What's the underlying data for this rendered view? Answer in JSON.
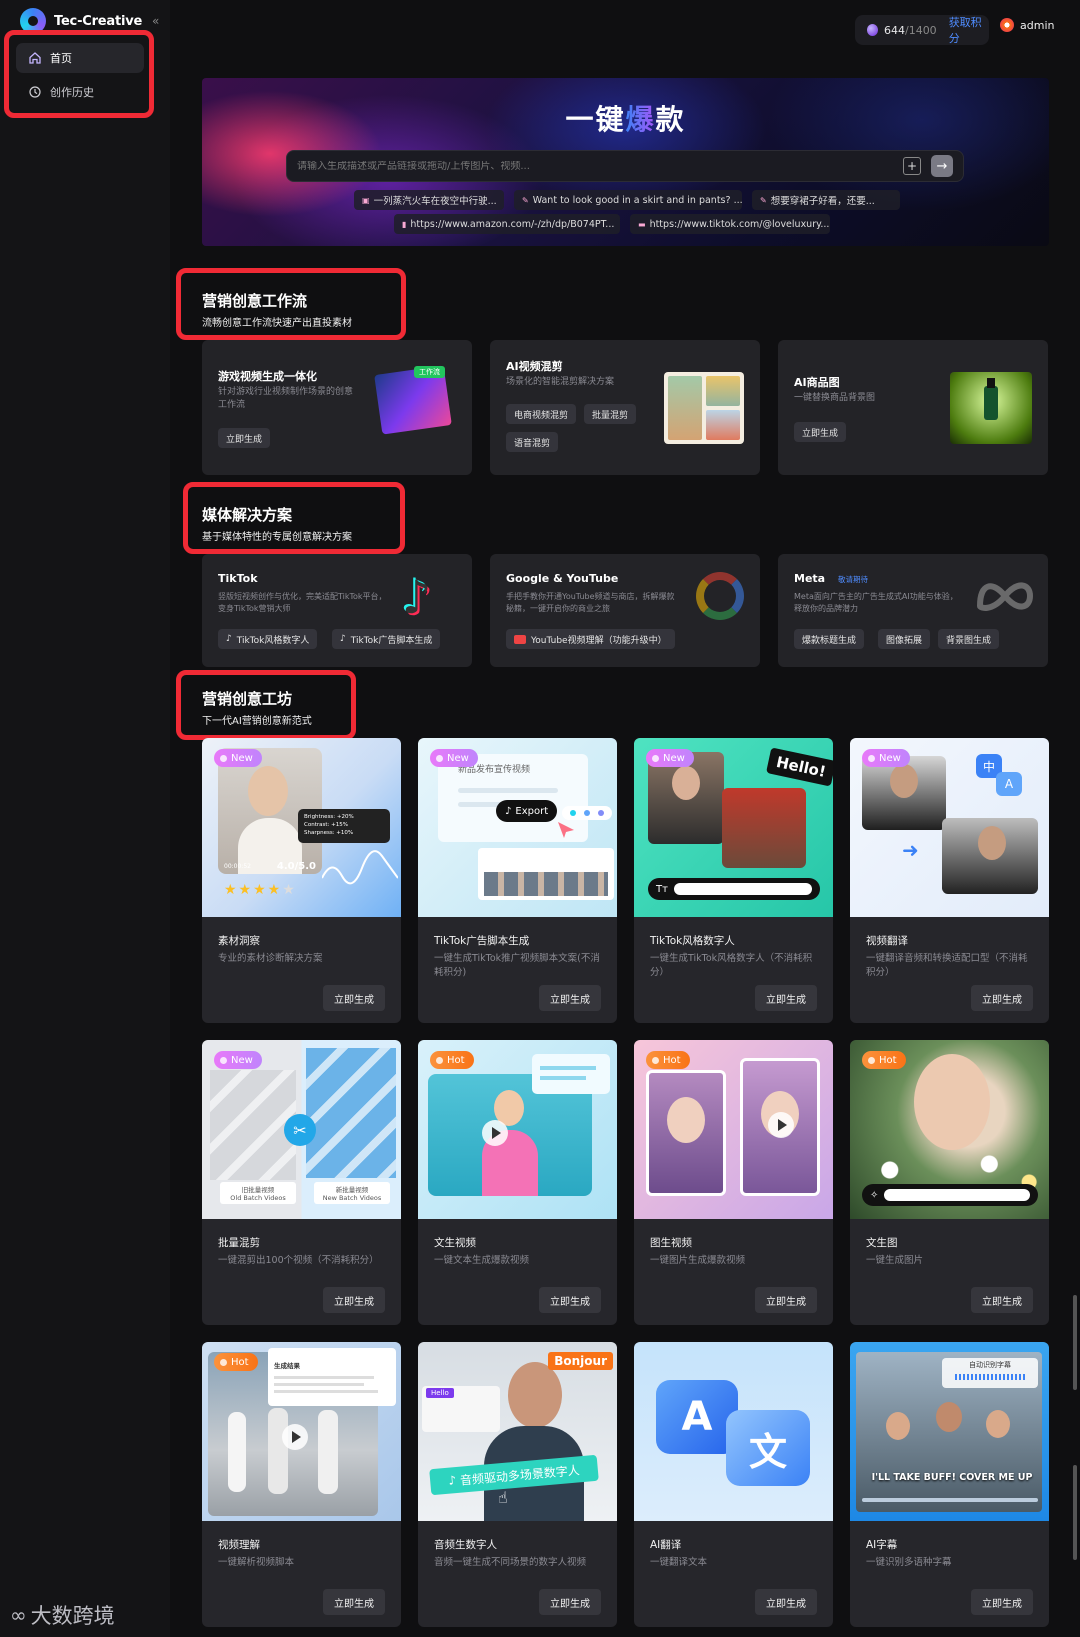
{
  "app": {
    "name": "Tec-Creative",
    "name_tm": "™",
    "collapse_icon": "chevrons-left-icon"
  },
  "sidebar": {
    "items": [
      {
        "label": "首页",
        "icon": "home-icon",
        "active": true
      },
      {
        "label": "创作历史",
        "icon": "history-icon",
        "active": false
      }
    ]
  },
  "topbar": {
    "credits_used": "644",
    "credits_total": "/1400",
    "earn_label": "获取积分",
    "user_name": "admin"
  },
  "hero": {
    "title_pre": "一键",
    "title_hl": "爆",
    "title_post": "款",
    "search_placeholder": "请输入生成描述或产品链接或拖动/上传图片、视频...",
    "chips": [
      "一列蒸汽火车在夜空中行驶...",
      "Want to look good in a skirt and in pants? ...",
      "想要穿裙子好看，还要...",
      "https://www.amazon.com/-/zh/dp/B074PT...",
      "https://www.tiktok.com/@loveluxury..."
    ]
  },
  "sections": {
    "workflow": {
      "title": "营销创意工作流",
      "subtitle": "流畅创意工作流快速产出直投素材"
    },
    "media": {
      "title": "媒体解决方案",
      "subtitle": "基于媒体特性的专属创意解决方案"
    },
    "workshop": {
      "title": "营销创意工坊",
      "subtitle": "下一代AI营销创意新范式"
    }
  },
  "workflow_cards": [
    {
      "title": "游戏视频生成一体化",
      "desc": "针对游戏行业视频制作场景的创意工作流",
      "buttons": [
        "立即生成"
      ],
      "tag": "工作流"
    },
    {
      "title": "AI视频混剪",
      "desc": "场景化的智能混剪解决方案",
      "buttons": [
        "电商视频混剪",
        "批量混剪",
        "语音混剪"
      ]
    },
    {
      "title": "AI商品图",
      "desc": "一键替换商品背景图",
      "buttons": [
        "立即生成"
      ]
    }
  ],
  "media_cards": [
    {
      "title": "TikTok",
      "desc": "竖版短视频创作与优化，完美适配TikTok平台，变身TikTok营销大师",
      "buttons": [
        "TikTok风格数字人",
        "TikTok广告脚本生成"
      ]
    },
    {
      "title": "Google & YouTube",
      "desc": "手把手教你开通YouTube频道与商店，拆解爆款秘籍，一键开启你的商业之旅",
      "buttons": [
        "YouTube视频理解（功能升级中）"
      ]
    },
    {
      "title": "Meta",
      "badge": "敬请期待",
      "desc": "Meta面向广告主的广告生成式AI功能与体验，释放你的品牌潜力",
      "buttons": [
        "爆款标题生成",
        "图像拓展",
        "背景图生成"
      ]
    }
  ],
  "tiles": [
    {
      "name": "素材洞察",
      "desc": "专业的素材诊断解决方案",
      "button": "立即生成",
      "badge": "New",
      "overlay": {
        "score": "4.0/5.0",
        "time": "00:00:52",
        "stats": [
          "Brightness: +20%",
          "Contrast: +15%",
          "Sharpness: +10%"
        ]
      }
    },
    {
      "name": "TikTok广告脚本生成",
      "desc": "一键生成TikTok推广视频脚本文案(不消耗积分)",
      "button": "立即生成",
      "badge": "New",
      "overlay": {
        "heading": "新品发布宣传视频",
        "export": "Export"
      }
    },
    {
      "name": "TikTok风格数字人",
      "desc": "一键生成TikTok风格数字人（不消耗积分）",
      "button": "立即生成",
      "badge": "New",
      "overlay": {
        "hello": "Hello!",
        "tt": "Tт"
      }
    },
    {
      "name": "视频翻译",
      "desc": "一键翻译音频和转换适配口型（不消耗积分）",
      "button": "立即生成",
      "badge": "New",
      "overlay": {
        "zh": "中",
        "a": "A"
      }
    },
    {
      "name": "批量混剪",
      "desc": "一键混剪出100个视频（不消耗积分）",
      "button": "立即生成",
      "badge": "New",
      "overlay": {
        "old_zh": "旧批量视频",
        "old_en": "Old Batch Videos",
        "new_zh": "新批量视频",
        "new_en": "New Batch Videos"
      }
    },
    {
      "name": "文生视频",
      "desc": "一键文本生成爆款视频",
      "button": "立即生成",
      "badge": "Hot"
    },
    {
      "name": "图生视频",
      "desc": "一键图片生成爆款视频",
      "button": "立即生成",
      "badge": "Hot"
    },
    {
      "name": "文生图",
      "desc": "一键生成图片",
      "button": "立即生成",
      "badge": "Hot"
    },
    {
      "name": "视频理解",
      "desc": "一键解析视频脚本",
      "button": "立即生成",
      "badge": "Hot",
      "overlay": {
        "panel_title": "生成结果"
      }
    },
    {
      "name": "音频生数字人",
      "desc": "音频一键生成不同场景的数字人视频",
      "button": "立即生成",
      "overlay": {
        "bonjour": "Bonjour",
        "hello": "Hello",
        "banner": "音频驱动多场景数字人"
      }
    },
    {
      "name": "AI翻译",
      "desc": "一键翻译文本",
      "button": "立即生成",
      "overlay": {
        "a": "A",
        "zh": "文"
      }
    },
    {
      "name": "AI字幕",
      "desc": "一键识别多语种字幕",
      "button": "立即生成",
      "overlay": {
        "label": "自动识别字幕",
        "caption": "I'LL TAKE BUFF! COVER ME UP"
      }
    }
  ],
  "watermark": "大数跨境",
  "colors": {
    "accent": "#4f8cff",
    "highlight_box": "#f02a35",
    "badge_new": "#d98bf5",
    "badge_hot": "#f97316"
  }
}
